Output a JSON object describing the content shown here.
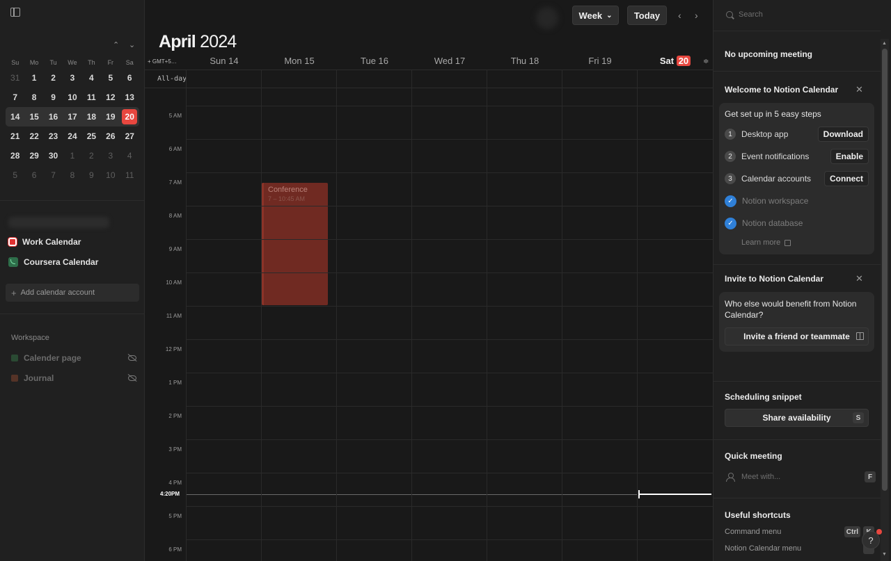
{
  "sidebar": {
    "mini_calendar": {
      "weekdays": [
        "Su",
        "Mo",
        "Tu",
        "We",
        "Th",
        "Fr",
        "Sa"
      ],
      "weeks": [
        [
          {
            "d": "31",
            "dim": true
          },
          {
            "d": "1"
          },
          {
            "d": "2"
          },
          {
            "d": "3"
          },
          {
            "d": "4"
          },
          {
            "d": "5"
          },
          {
            "d": "6"
          }
        ],
        [
          {
            "d": "7"
          },
          {
            "d": "8"
          },
          {
            "d": "9"
          },
          {
            "d": "10"
          },
          {
            "d": "11"
          },
          {
            "d": "12"
          },
          {
            "d": "13"
          }
        ],
        [
          {
            "d": "14"
          },
          {
            "d": "15"
          },
          {
            "d": "16"
          },
          {
            "d": "17"
          },
          {
            "d": "18"
          },
          {
            "d": "19"
          },
          {
            "d": "20",
            "today": true
          }
        ],
        [
          {
            "d": "21"
          },
          {
            "d": "22"
          },
          {
            "d": "23"
          },
          {
            "d": "24"
          },
          {
            "d": "25"
          },
          {
            "d": "26"
          },
          {
            "d": "27"
          }
        ],
        [
          {
            "d": "28"
          },
          {
            "d": "29"
          },
          {
            "d": "30"
          },
          {
            "d": "1",
            "dim": true
          },
          {
            "d": "2",
            "dim": true
          },
          {
            "d": "3",
            "dim": true
          },
          {
            "d": "4",
            "dim": true
          }
        ],
        [
          {
            "d": "5",
            "dim": true
          },
          {
            "d": "6",
            "dim": true
          },
          {
            "d": "7",
            "dim": true
          },
          {
            "d": "8",
            "dim": true
          },
          {
            "d": "9",
            "dim": true
          },
          {
            "d": "10",
            "dim": true
          },
          {
            "d": "11",
            "dim": true
          }
        ]
      ],
      "current_week_index": 2
    },
    "calendars": [
      {
        "label": "Work Calendar",
        "color": "#e03131"
      },
      {
        "label": "Coursera Calendar",
        "color": "#2e6e4a"
      }
    ],
    "add_calendar_label": "Add calendar account",
    "workspace_title": "Workspace",
    "workspace_items": [
      {
        "label": "Calender page",
        "color": "#2a4a33"
      },
      {
        "label": "Journal",
        "color": "#553327"
      }
    ]
  },
  "header": {
    "view_label": "Week",
    "today_label": "Today",
    "month": "April",
    "year": "2024"
  },
  "week": {
    "timezone_label": "GMT+5…",
    "allday_label": "All-day",
    "days": [
      {
        "label": "Sun 14"
      },
      {
        "label": "Mon 15"
      },
      {
        "label": "Tue 16"
      },
      {
        "label": "Wed 17"
      },
      {
        "label": "Thu 18"
      },
      {
        "label": "Fri 19"
      },
      {
        "name": "Sat",
        "num": "20",
        "today": true
      }
    ],
    "hours": [
      "5 AM",
      "6 AM",
      "7 AM",
      "8 AM",
      "9 AM",
      "10 AM",
      "11 AM",
      "12 PM",
      "1 PM",
      "2 PM",
      "3 PM",
      "4 PM",
      "5 PM",
      "6 PM"
    ],
    "now_label": "4:20PM",
    "events": [
      {
        "title": "Conference",
        "time": "7 – 10:45 AM",
        "day": "Mon 15",
        "color": "#702a22"
      }
    ]
  },
  "right_panel": {
    "search_placeholder": "Search",
    "no_meeting": "No upcoming meeting",
    "welcome": {
      "title": "Welcome to Notion Calendar",
      "setup_title": "Get set up in 5 easy steps",
      "steps": [
        {
          "num": "1",
          "label": "Desktop app",
          "button": "Download"
        },
        {
          "num": "2",
          "label": "Event notifications",
          "button": "Enable"
        },
        {
          "num": "3",
          "label": "Calendar accounts",
          "button": "Connect"
        },
        {
          "label": "Notion workspace",
          "done": true
        },
        {
          "label": "Notion database",
          "done": true
        }
      ],
      "learn_more": "Learn more"
    },
    "invite": {
      "title": "Invite to Notion Calendar",
      "text": "Who else would benefit from Notion Calendar?",
      "button": "Invite a friend or teammate"
    },
    "scheduling": {
      "title": "Scheduling snippet",
      "button": "Share availability",
      "shortcut": "S"
    },
    "quick_meeting": {
      "title": "Quick meeting",
      "placeholder": "Meet with...",
      "shortcut": "F"
    },
    "shortcuts": {
      "title": "Useful shortcuts",
      "items": [
        {
          "label": "Command menu",
          "keys": [
            "Ctrl",
            "K"
          ]
        },
        {
          "label": "Notion Calendar menu",
          "keys": [
            "`"
          ]
        }
      ]
    },
    "help_label": "?"
  }
}
